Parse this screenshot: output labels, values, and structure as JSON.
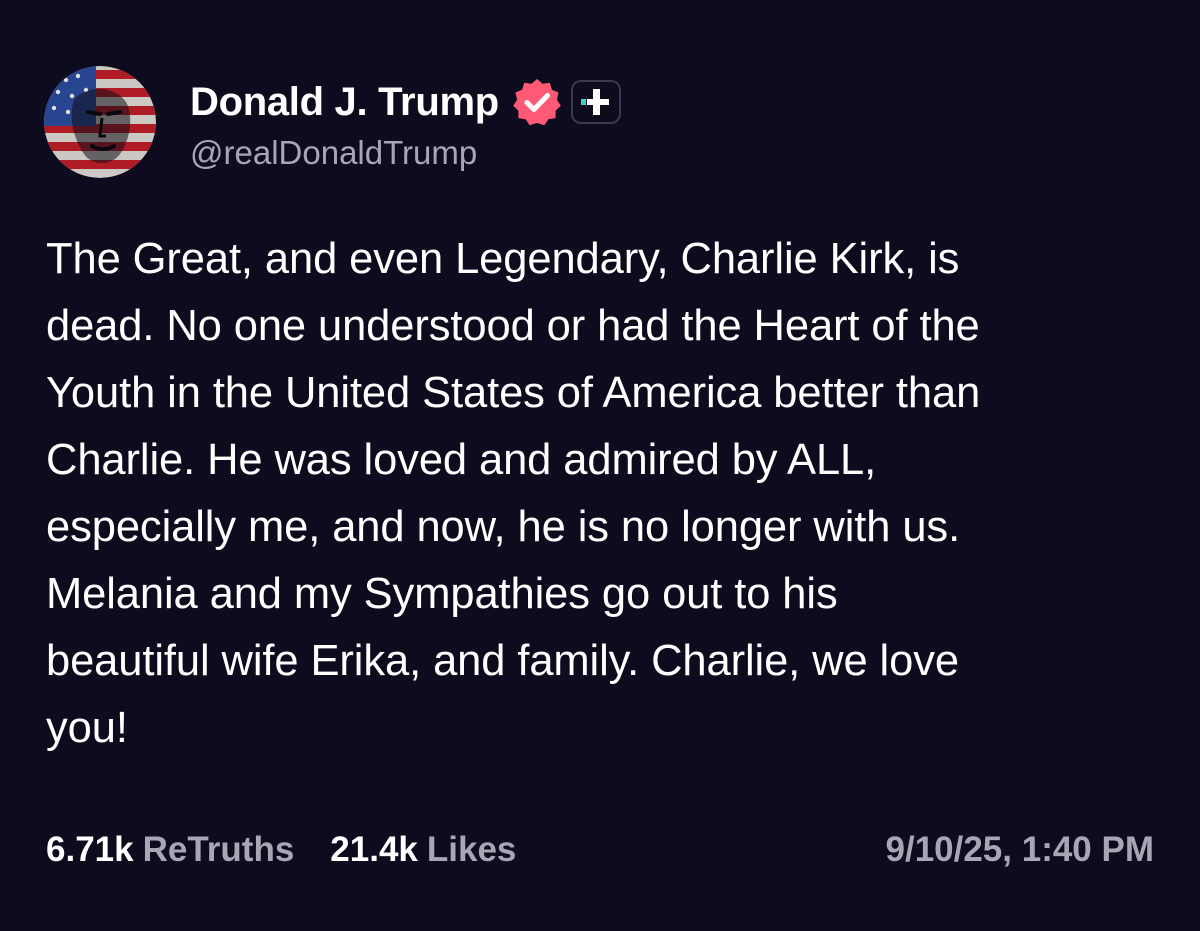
{
  "post": {
    "author": {
      "display_name": "Donald J. Trump",
      "handle": "@realDonaldTrump",
      "verified_badge_icon": "verified-check-icon",
      "follow_badge_icon": "plus-icon",
      "avatar_icon": "avatar-flag-portrait",
      "verified_color": "#ff5a75",
      "accent_color": "#3bd3b6"
    },
    "body_lines": [
      "The Great, and even Legendary, Charlie Kirk, is",
      "dead. No one understood or had the Heart of the",
      "Youth in the United States of America better than",
      "Charlie. He was loved and admired by ALL,",
      "especially me, and now, he is no longer with us.",
      "Melania and my Sympathies go out to his",
      "beautiful wife Erika, and family. Charlie, we love",
      "you!"
    ],
    "stats": {
      "retruths_count": "6.71k",
      "retruths_label": "ReTruths",
      "likes_count": "21.4k",
      "likes_label": "Likes"
    },
    "timestamp": "9/10/25, 1:40 PM"
  },
  "colors": {
    "background": "#0d0b1e",
    "text_primary": "#ffffff",
    "text_secondary": "#a8a6b4"
  }
}
